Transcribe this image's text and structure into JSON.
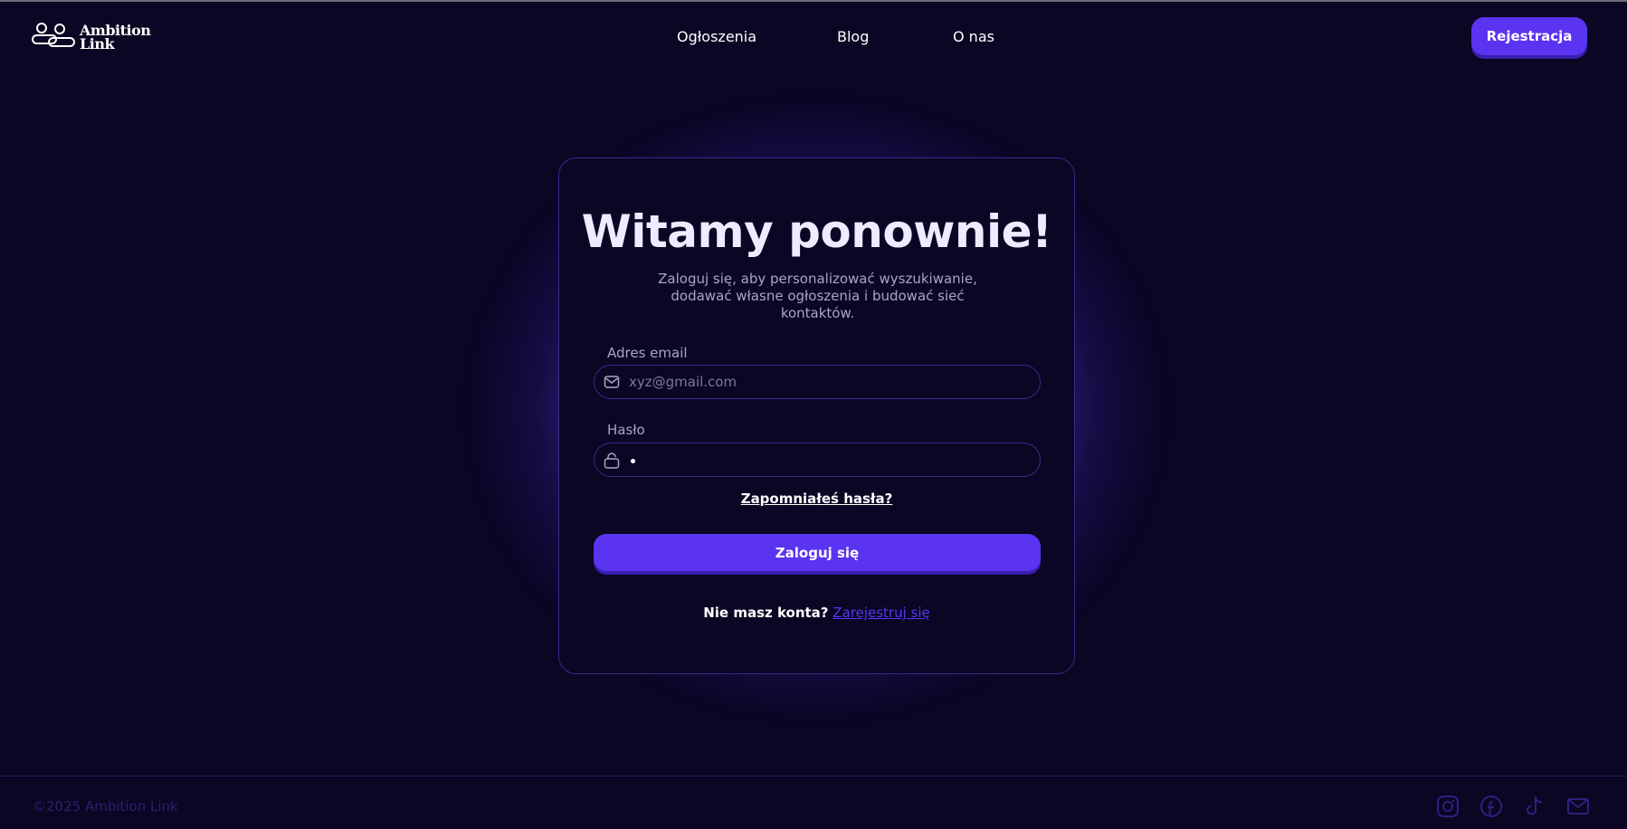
{
  "header": {
    "logo": {
      "line1": "Ambition",
      "line2": "Link"
    },
    "nav": [
      "Ogłoszenia",
      "Blog",
      "O nas"
    ],
    "register_label": "Rejestracja"
  },
  "login": {
    "title": "Witamy ponownie!",
    "subtitle": "Zaloguj się, aby personalizować wyszukiwanie, dodawać własne ogłoszenia i budować sieć kontaktów.",
    "email_label": "Adres email",
    "email_placeholder": "xyz@gmail.com",
    "password_label": "Hasło",
    "forgot_label": "Zapomniałeś hasła?",
    "submit_label": "Zaloguj się",
    "no_account_text": "Nie masz konta?",
    "signup_link": "Zarejestruj się"
  },
  "footer": {
    "copyright": "©2025 Ambition Link",
    "socials": [
      "instagram-icon",
      "facebook-icon",
      "tiktok-icon",
      "mail-icon"
    ]
  },
  "colors": {
    "background": "#0a0624",
    "accent": "#5b34f2",
    "border": "#3a2a8a"
  }
}
